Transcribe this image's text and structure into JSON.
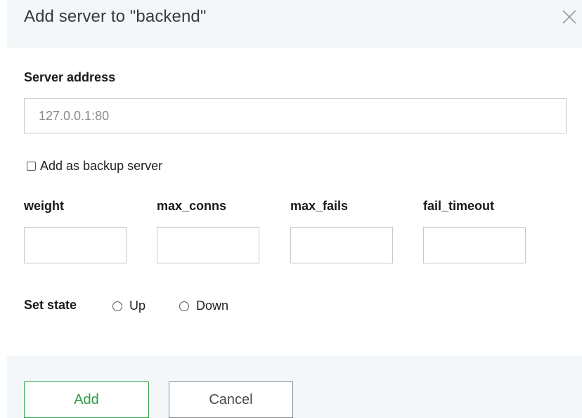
{
  "dialog": {
    "title": "Add server to \"backend\""
  },
  "form": {
    "server_address_label": "Server address",
    "server_address_placeholder": "127.0.0.1:80",
    "server_address_value": "",
    "backup_checkbox_label": "Add as backup server",
    "backup_checked": false,
    "params": [
      {
        "label": "weight",
        "value": ""
      },
      {
        "label": "max_conns",
        "value": ""
      },
      {
        "label": "max_fails",
        "value": ""
      },
      {
        "label": "fail_timeout",
        "value": ""
      }
    ],
    "state_label": "Set state",
    "state_options": [
      {
        "label": "Up",
        "selected": false
      },
      {
        "label": "Down",
        "selected": false
      }
    ]
  },
  "footer": {
    "add_label": "Add",
    "cancel_label": "Cancel"
  },
  "colors": {
    "accent_green": "#2fa24a",
    "header_bg": "#f4f7f9"
  },
  "icons": {
    "close": "close-icon"
  }
}
